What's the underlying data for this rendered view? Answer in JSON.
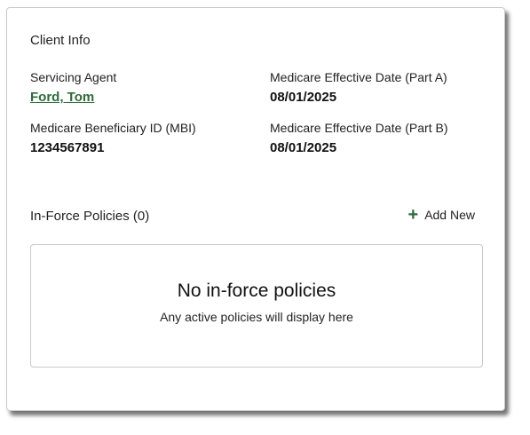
{
  "client_info": {
    "title": "Client Info",
    "servicing_agent": {
      "label": "Servicing Agent",
      "value": "Ford, Tom"
    },
    "medicare_part_a": {
      "label": "Medicare Effective Date (Part A)",
      "value": "08/01/2025"
    },
    "mbi": {
      "label": "Medicare Beneficiary ID (MBI)",
      "value": "1234567891"
    },
    "medicare_part_b": {
      "label": "Medicare Effective Date (Part B)",
      "value": "08/01/2025"
    }
  },
  "policies": {
    "title": "In-Force Policies (0)",
    "add_new_label": "Add New",
    "add_icon": "plus-icon",
    "empty_title": "No in-force policies",
    "empty_subtitle": "Any active policies will display here"
  },
  "colors": {
    "accent_green": "#2e6b3a",
    "border": "#c9c9c9"
  }
}
